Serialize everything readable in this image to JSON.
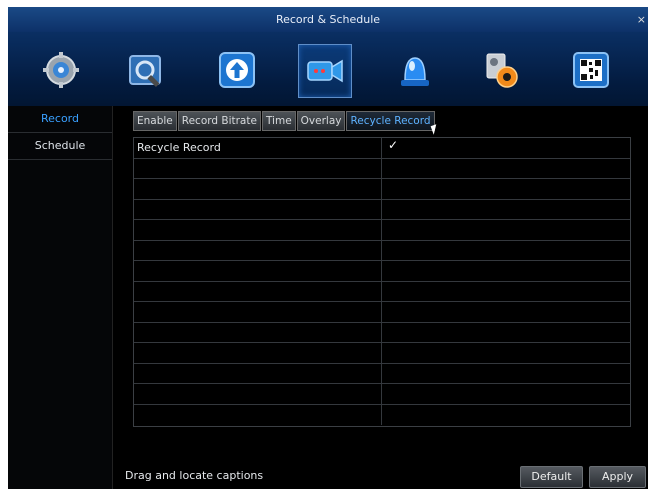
{
  "window": {
    "title": "Record & Schedule",
    "close_glyph": "×"
  },
  "toolbar": {
    "icons": [
      {
        "name": "system-gear-icon"
      },
      {
        "name": "search-playback-icon"
      },
      {
        "name": "upload-icon"
      },
      {
        "name": "camera-record-icon"
      },
      {
        "name": "alarm-siren-icon"
      },
      {
        "name": "settings-disk-icon"
      },
      {
        "name": "qr-code-icon"
      }
    ]
  },
  "sidebar": {
    "items": [
      {
        "label": "Record"
      },
      {
        "label": "Schedule"
      }
    ]
  },
  "tabs": [
    {
      "label": "Enable"
    },
    {
      "label": "Record Bitrate"
    },
    {
      "label": "Time"
    },
    {
      "label": "Overlay"
    },
    {
      "label": "Recycle Record"
    }
  ],
  "table": {
    "row1": {
      "label": "Recycle Record",
      "checked": "✓"
    }
  },
  "footer": {
    "caption": "Drag and locate captions",
    "default_label": "Default",
    "apply_label": "Apply"
  }
}
